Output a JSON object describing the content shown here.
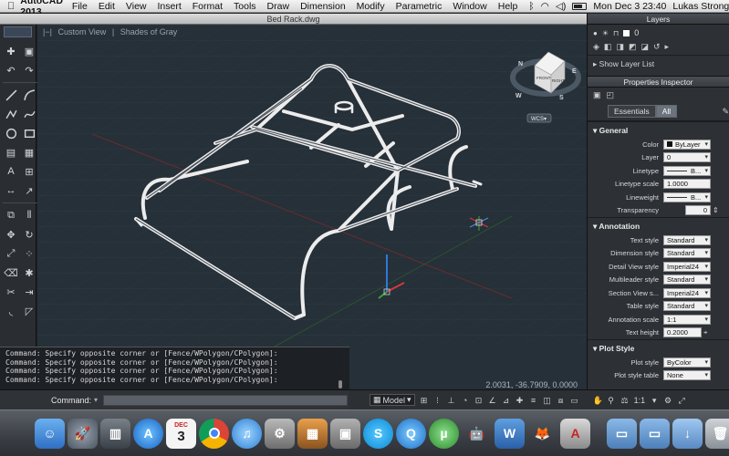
{
  "menubar": {
    "app": "AutoCAD 2013",
    "items": [
      "File",
      "Edit",
      "View",
      "Insert",
      "Format",
      "Tools",
      "Draw",
      "Dimension",
      "Modify",
      "Parametric",
      "Window",
      "Help"
    ],
    "datetime": "Mon Dec 3  23:40",
    "user": "Lukas Strong"
  },
  "window": {
    "title": "Bed Rack.dwg"
  },
  "viewport": {
    "view_label": "Custom View",
    "style_label": "Shades of Gray",
    "viewcube_face": "FRONT",
    "viewcube_side": "RIGHT",
    "compass": [
      "N",
      "E",
      "S",
      "W"
    ],
    "wcs_label": "WCS",
    "coordinates": "2.0031, -36.7909, 0.0000"
  },
  "command": {
    "history": [
      "Command: Specify opposite corner or [Fence/WPolygon/CPolygon]:",
      "Command: Specify opposite corner or [Fence/WPolygon/CPolygon]:",
      "Command: Specify opposite corner or [Fence/WPolygon/CPolygon]:",
      "Command: Specify opposite corner or [Fence/WPolygon/CPolygon]:"
    ],
    "label": "Command:",
    "value": ""
  },
  "statusbar": {
    "model": "Model",
    "scale": "1:1"
  },
  "layers": {
    "title": "Layers",
    "current": "0",
    "show_list": "Show Layer List"
  },
  "properties": {
    "title": "Properties Inspector",
    "tabs": [
      "Essentials",
      "All"
    ],
    "active_tab": "All",
    "general": {
      "title": "General",
      "rows": [
        {
          "label": "Color",
          "value": "ByLayer"
        },
        {
          "label": "Layer",
          "value": "0"
        },
        {
          "label": "Linetype",
          "value": "B..."
        },
        {
          "label": "Linetype scale",
          "value": "1.0000"
        },
        {
          "label": "Lineweight",
          "value": "B..."
        },
        {
          "label": "Transparency",
          "value": "0"
        }
      ]
    },
    "annotation": {
      "title": "Annotation",
      "rows": [
        {
          "label": "Text style",
          "value": "Standard"
        },
        {
          "label": "Dimension style",
          "value": "Standard"
        },
        {
          "label": "Detail View style",
          "value": "Imperial24"
        },
        {
          "label": "Multileader style",
          "value": "Standard"
        },
        {
          "label": "Section View s...",
          "value": "Imperial24"
        },
        {
          "label": "Table style",
          "value": "Standard"
        },
        {
          "label": "Annotation scale",
          "value": "1:1"
        },
        {
          "label": "Text height",
          "value": "0.2000"
        }
      ]
    },
    "plot": {
      "title": "Plot Style",
      "rows": [
        {
          "label": "Plot style",
          "value": "ByColor"
        },
        {
          "label": "Plot style table",
          "value": "None"
        }
      ]
    }
  },
  "dock": {
    "calendar_month": "DEC",
    "calendar_day": "3"
  },
  "colors": {
    "viewport_bg": "#263039",
    "panel_bg": "#2d3136",
    "frame": "#e8e8e8"
  }
}
